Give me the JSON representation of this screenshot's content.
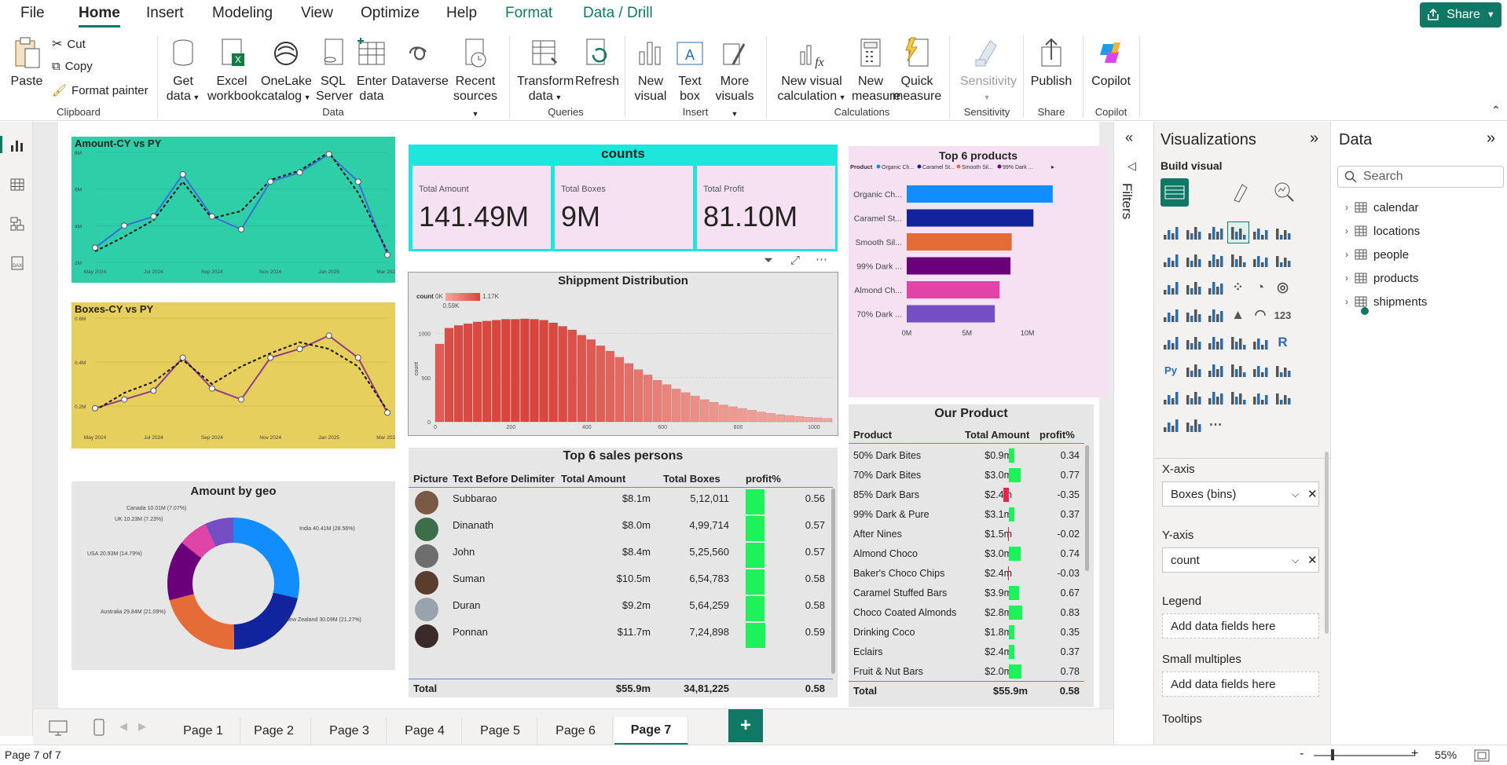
{
  "menu": {
    "items": [
      "File",
      "Home",
      "Insert",
      "Modeling",
      "View",
      "Optimize",
      "Help",
      "Format",
      "Data / Drill"
    ],
    "share": "Share"
  },
  "ribbon": {
    "clipboard": {
      "paste": "Paste",
      "cut": "Cut",
      "copy": "Copy",
      "format_painter": "Format painter",
      "group": "Clipboard"
    },
    "data": {
      "get_data": [
        "Get",
        "data"
      ],
      "excel": [
        "Excel",
        "workbook"
      ],
      "onelake": [
        "OneLake",
        "catalog"
      ],
      "sql": [
        "SQL",
        "Server"
      ],
      "enter": [
        "Enter",
        "data"
      ],
      "dataverse": "Dataverse",
      "recent": [
        "Recent",
        "sources"
      ],
      "group": "Data"
    },
    "queries": {
      "transform": [
        "Transform",
        "data"
      ],
      "refresh": "Refresh",
      "group": "Queries"
    },
    "insert": {
      "new_visual": [
        "New",
        "visual"
      ],
      "text_box": [
        "Text",
        "box"
      ],
      "more_visuals": [
        "More",
        "visuals"
      ],
      "group": "Insert"
    },
    "calculations": {
      "new_visual_calc": [
        "New visual",
        "calculation"
      ],
      "new_measure": [
        "New",
        "measure"
      ],
      "quick_measure": [
        "Quick",
        "measure"
      ],
      "group": "Calculations"
    },
    "sensitivity": {
      "label": "Sensitivity",
      "group": "Sensitivity"
    },
    "share": {
      "publish": "Publish",
      "group": "Share"
    },
    "copilot": {
      "label": "Copilot",
      "group": "Copilot"
    }
  },
  "visuals": {
    "amount_cy": {
      "title": "Amount-CY vs PY",
      "yticks": [
        "8M",
        "6M",
        "4M",
        "2M"
      ],
      "xticks": [
        "May 2024",
        "Jul 2024",
        "Sep 2024",
        "Nov 2024",
        "Jan 2025",
        "Mar 2025"
      ]
    },
    "boxes_cy": {
      "title": "Boxes-CY vs PY",
      "yticks": [
        "0.6M",
        "0.4M",
        "0.2M"
      ],
      "xticks": [
        "May 2024",
        "Jul 2024",
        "Sep 2024",
        "Nov 2024",
        "Jan 2025",
        "Mar 2025"
      ]
    },
    "geo": {
      "title": "Amount by geo",
      "labels": [
        "Canada 10.01M (7.07%)",
        "UK 10.23M (7.23%)",
        "USA 20.93M (14.79%)",
        "Australia 29.84M (21.09%)",
        "New Zealand 30.09M (21.27%)",
        "India 40.41M (28.56%)"
      ]
    },
    "counts": {
      "title": "counts",
      "kpis": [
        {
          "label": "Total Amount",
          "value": "141.49M"
        },
        {
          "label": "Total Boxes",
          "value": "9M"
        },
        {
          "label": "Total Profit",
          "value": "81.10M"
        }
      ]
    },
    "shipment": {
      "title": "Shippment Distribution",
      "legend_title": "count",
      "legend_min": "0K",
      "legend_mid": "0.59K",
      "legend_max": "1.17K",
      "ylabel": "count",
      "yticks": [
        "1000",
        "500",
        "0"
      ],
      "xticks": [
        "0",
        "200",
        "400",
        "600",
        "800",
        "1000"
      ]
    },
    "top6products": {
      "title": "Top 6 products",
      "legend_label": "Product",
      "legend_items": [
        "Organic Ch...",
        "Caramel St...",
        "Smooth Sil...",
        "99% Dark ..."
      ],
      "xticks": [
        "0M",
        "5M",
        "10M"
      ]
    },
    "salespersons": {
      "title": "Top 6 sales persons",
      "headers": [
        "Picture",
        "Text Before Delimiter",
        "Total Amount",
        "Total Boxes",
        "profit%"
      ],
      "rows": [
        {
          "name": "Subbarao",
          "amount": "$8.1m",
          "boxes": "5,12,011",
          "profit": "0.56"
        },
        {
          "name": "Dinanath",
          "amount": "$8.0m",
          "boxes": "4,99,714",
          "profit": "0.57"
        },
        {
          "name": "John",
          "amount": "$8.4m",
          "boxes": "5,25,560",
          "profit": "0.57"
        },
        {
          "name": "Suman",
          "amount": "$10.5m",
          "boxes": "6,54,783",
          "profit": "0.58"
        },
        {
          "name": "Duran",
          "amount": "$9.2m",
          "boxes": "5,64,259",
          "profit": "0.58"
        },
        {
          "name": "Ponnan",
          "amount": "$11.7m",
          "boxes": "7,24,898",
          "profit": "0.59"
        }
      ],
      "total": {
        "label": "Total",
        "amount": "$55.9m",
        "boxes": "34,81,225",
        "profit": "0.58"
      }
    },
    "ourproduct": {
      "title": "Our Product",
      "headers": [
        "Product",
        "Total Amount",
        "profit%"
      ],
      "rows": [
        {
          "name": "50% Dark Bites",
          "amount": "$0.9m",
          "profit": "0.34"
        },
        {
          "name": "70% Dark Bites",
          "amount": "$3.0m",
          "profit": "0.77"
        },
        {
          "name": "85% Dark Bars",
          "amount": "$2.4m",
          "profit": "-0.35"
        },
        {
          "name": "99% Dark & Pure",
          "amount": "$3.1m",
          "profit": "0.37"
        },
        {
          "name": "After Nines",
          "amount": "$1.5m",
          "profit": "-0.02"
        },
        {
          "name": "Almond Choco",
          "amount": "$3.0m",
          "profit": "0.74"
        },
        {
          "name": "Baker's Choco Chips",
          "amount": "$2.4m",
          "profit": "-0.03"
        },
        {
          "name": "Caramel Stuffed Bars",
          "amount": "$3.9m",
          "profit": "0.67"
        },
        {
          "name": "Choco Coated Almonds",
          "amount": "$2.8m",
          "profit": "0.83"
        },
        {
          "name": "Drinking Coco",
          "amount": "$1.8m",
          "profit": "0.35"
        },
        {
          "name": "Eclairs",
          "amount": "$2.4m",
          "profit": "0.37"
        },
        {
          "name": "Fruit & Nut Bars",
          "amount": "$2.0m",
          "profit": "0.78"
        }
      ],
      "total": {
        "label": "Total",
        "amount": "$55.9m",
        "profit": "0.58"
      }
    }
  },
  "chart_data": [
    {
      "type": "line",
      "title": "Amount-CY vs PY",
      "x": [
        "May 2024",
        "Jun 2024",
        "Jul 2024",
        "Aug 2024",
        "Sep 2024",
        "Oct 2024",
        "Nov 2024",
        "Dec 2024",
        "Jan 2025",
        "Feb 2025",
        "Mar 2025"
      ],
      "series": [
        {
          "values": [
            2.8,
            4.0,
            4.5,
            6.8,
            4.5,
            3.8,
            6.4,
            6.9,
            7.9,
            6.4,
            2.4
          ]
        },
        {
          "values": [
            2.6,
            3.4,
            4.3,
            6.4,
            4.4,
            4.8,
            6.5,
            7.0,
            8.0,
            5.8,
            2.6
          ]
        }
      ],
      "ylim": [
        2,
        8
      ]
    },
    {
      "type": "line",
      "title": "Boxes-CY vs PY",
      "x": [
        "May 2024",
        "Jun 2024",
        "Jul 2024",
        "Aug 2024",
        "Sep 2024",
        "Oct 2024",
        "Nov 2024",
        "Dec 2024",
        "Jan 2025",
        "Feb 2025",
        "Mar 2025"
      ],
      "series": [
        {
          "values": [
            0.19,
            0.23,
            0.27,
            0.42,
            0.28,
            0.23,
            0.42,
            0.46,
            0.52,
            0.42,
            0.17
          ]
        },
        {
          "values": [
            0.18,
            0.26,
            0.31,
            0.41,
            0.3,
            0.38,
            0.44,
            0.49,
            0.46,
            0.38,
            0.18
          ]
        }
      ],
      "ylim": [
        0.1,
        0.6
      ]
    },
    {
      "type": "pie",
      "title": "Amount by geo",
      "categories": [
        "India",
        "New Zealand",
        "Australia",
        "USA",
        "UK",
        "Canada"
      ],
      "values": [
        40.41,
        30.09,
        29.84,
        20.93,
        10.23,
        10.01
      ],
      "colors": [
        "#118dff",
        "#12239e",
        "#e66c37",
        "#6b007b",
        "#e044a7",
        "#744ec2"
      ]
    },
    {
      "type": "bar",
      "title": "Shippment Distribution",
      "x_start": 0,
      "bin_width": 25,
      "values": [
        880,
        1060,
        1090,
        1110,
        1130,
        1140,
        1150,
        1160,
        1160,
        1165,
        1160,
        1150,
        1120,
        1080,
        1040,
        980,
        930,
        860,
        800,
        730,
        660,
        590,
        530,
        470,
        420,
        370,
        330,
        290,
        250,
        220,
        190,
        170,
        150,
        130,
        110,
        95,
        80,
        70,
        60,
        50,
        45,
        38
      ],
      "ylim": [
        0,
        1200
      ],
      "xlim": [
        0,
        1050
      ]
    },
    {
      "type": "bar",
      "title": "Top 6 products",
      "categories": [
        "Organic Ch...",
        "Caramel St...",
        "Smooth Sil...",
        "99% Dark ...",
        "Almond Ch...",
        "70% Dark ..."
      ],
      "values": [
        12.1,
        10.5,
        8.7,
        8.6,
        7.7,
        7.3
      ],
      "colors": [
        "#118dff",
        "#12239e",
        "#e66c37",
        "#6b007b",
        "#e044a7",
        "#744ec2"
      ],
      "xlim": [
        0,
        12.5
      ]
    }
  ],
  "filters": {
    "label": "Filters"
  },
  "viz_pane": {
    "title": "Visualizations",
    "build": "Build visual",
    "xaxis": "X-axis",
    "xaxis_field": "Boxes (bins)",
    "yaxis": "Y-axis",
    "yaxis_field": "count",
    "legend": "Legend",
    "legend_ph": "Add data fields here",
    "small_mult": "Small multiples",
    "small_ph": "Add data fields here",
    "tooltips": "Tooltips"
  },
  "data_pane": {
    "title": "Data",
    "search_ph": "Search",
    "tables": [
      "calendar",
      "locations",
      "people",
      "products",
      "shipments"
    ]
  },
  "pages": [
    "Page 1",
    "Page 2",
    "Page 3",
    "Page 4",
    "Page 5",
    "Page 6",
    "Page 7"
  ],
  "status": {
    "page": "Page 7 of 7",
    "zoom": "55%"
  }
}
